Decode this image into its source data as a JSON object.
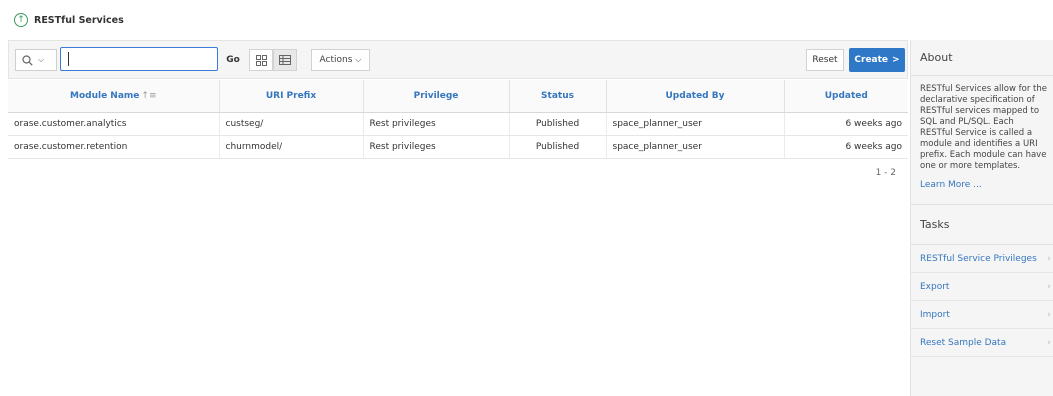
{
  "breadcrumb": {
    "icon": "arrow-up-circle-icon",
    "title": "RESTful Services"
  },
  "toolbar": {
    "search_icon": "magnifier-icon",
    "search_value": "",
    "go_label": "Go",
    "view_grid_icon": "grid-view-icon",
    "view_report_icon": "report-view-icon",
    "actions_label": "Actions",
    "reset_label": "Reset",
    "create_label": "Create",
    "create_arrow": ">"
  },
  "table": {
    "columns": [
      "Module Name",
      "URI Prefix",
      "Privilege",
      "Status",
      "Updated By",
      "Updated"
    ],
    "sort_indicator": "↑≡",
    "rows": [
      {
        "module_name": "orase.customer.analytics",
        "uri_prefix": "custseg/",
        "privilege": "Rest privileges",
        "status": "Published",
        "updated_by": "space_planner_user",
        "updated": "6 weeks ago"
      },
      {
        "module_name": "orase.customer.retention",
        "uri_prefix": "churnmodel/",
        "privilege": "Rest privileges",
        "status": "Published",
        "updated_by": "space_planner_user",
        "updated": "6 weeks ago"
      }
    ],
    "pagination": "1 - 2"
  },
  "sidebar": {
    "about_title": "About",
    "about_text": "RESTful Services allow for the declarative specification of RESTful services mapped to SQL and PL/SQL. Each RESTful Service is called a module and identifies a URI prefix. Each module can have one or more templates.",
    "learn_more": "Learn More ...",
    "tasks_title": "Tasks",
    "tasks": [
      {
        "label": "RESTful Service Privileges"
      },
      {
        "label": "Export"
      },
      {
        "label": "Import"
      },
      {
        "label": "Reset Sample Data"
      }
    ]
  },
  "colors": {
    "accent": "#2f78c8",
    "link": "#3576be",
    "brand_icon": "#3c9a5f"
  }
}
